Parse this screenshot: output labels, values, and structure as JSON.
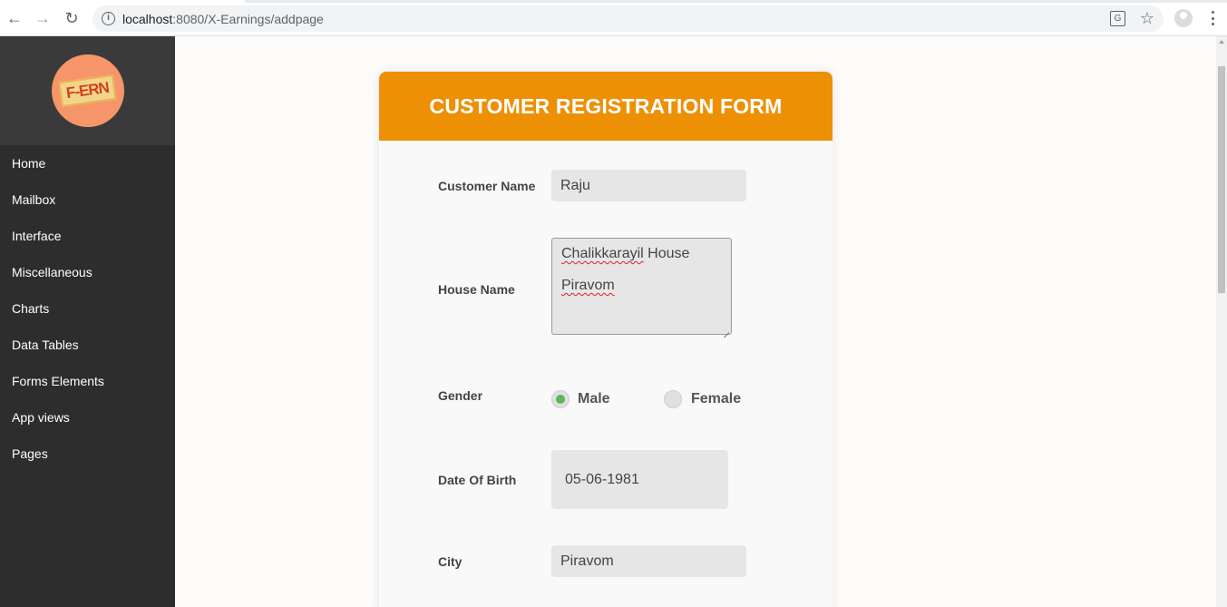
{
  "browser": {
    "url_host": "localhost",
    "url_path": ":8080/X-Earnings/addpage",
    "back_glyph": "←",
    "forward_glyph": "→",
    "reload_glyph": "↻",
    "translate_glyph": "G",
    "star_glyph": "☆",
    "info_glyph": "i"
  },
  "sidebar": {
    "logo_text": "F-ERN",
    "items": [
      {
        "label": "Home"
      },
      {
        "label": "Mailbox"
      },
      {
        "label": "Interface"
      },
      {
        "label": "Miscellaneous"
      },
      {
        "label": "Charts"
      },
      {
        "label": "Data Tables"
      },
      {
        "label": "Forms Elements"
      },
      {
        "label": "App views"
      },
      {
        "label": "Pages"
      }
    ]
  },
  "form": {
    "title": "CUSTOMER REGISTRATION FORM",
    "customer_name": {
      "label": "Customer Name",
      "value": "Raju"
    },
    "house_name": {
      "label": "House Name",
      "line1_word": "Chalikkarayil",
      "line1_rest": " House",
      "line2": "Piravom"
    },
    "gender": {
      "label": "Gender",
      "options": [
        "Male",
        "Female"
      ],
      "selected": "Male"
    },
    "dob": {
      "label": "Date Of Birth",
      "value": "05-06-1981"
    },
    "city": {
      "label": "City",
      "value": "Piravom"
    }
  },
  "colors": {
    "header": "#ed9006",
    "sidebar": "#2d2d2d",
    "radio_checked": "#5cb85c"
  }
}
